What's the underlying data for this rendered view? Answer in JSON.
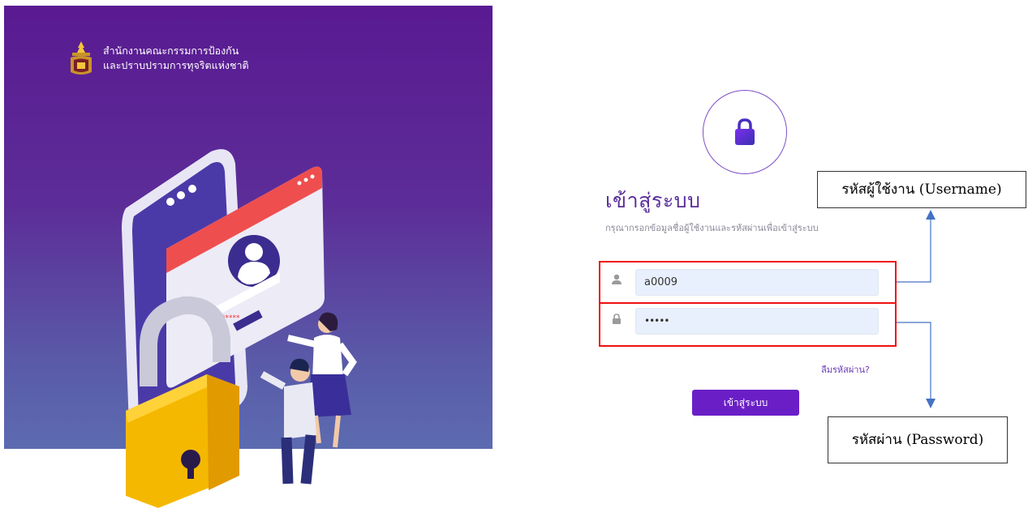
{
  "brand": {
    "line1": "สำนักงานคณะกรรมการป้องกัน",
    "line2": "และปราบปรามการทุจริตแห่งชาติ",
    "emblem_icon": "emblem-icon"
  },
  "login": {
    "lock_icon": "lock-icon",
    "title": "เข้าสู่ระบบ",
    "subtitle": "กรุณากรอกข้อมูลชื่อผู้ใช้งานและรหัสผ่านเพื่อเข้าสู่ระบบ",
    "username_value": "a0009",
    "username_icon": "user-icon",
    "password_value": "•••••",
    "password_icon": "lock-icon",
    "forgot_label": "ลืมรหัสผ่าน?",
    "submit_label": "เข้าสู่ระบบ",
    "accent_color": "#6a1fc6"
  },
  "annotations": {
    "username_callout": "รหัสผู้ใช้งาน (Username)",
    "password_callout": "รหัสผ่าน (Password)",
    "highlight_color": "#e11111",
    "arrow_color": "#4472c4"
  },
  "illustration": {
    "form_password_mask": "*****"
  }
}
